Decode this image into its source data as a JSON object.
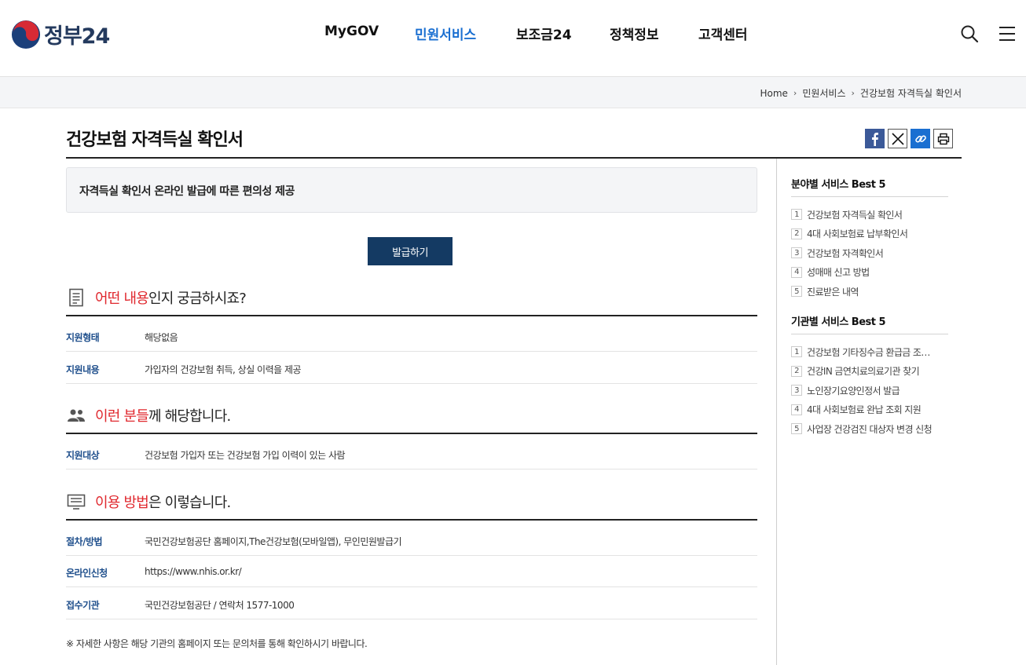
{
  "header": {
    "logo_text": "정부24",
    "nav": [
      {
        "label": "MyGOV"
      },
      {
        "label": "민원서비스"
      },
      {
        "label": "보조금24"
      },
      {
        "label": "정책정보"
      },
      {
        "label": "고객센터"
      }
    ],
    "active_nav": "민원서비스",
    "icons": [
      "search-icon",
      "menu-icon"
    ]
  },
  "breadcrumb": [
    "Home",
    "민원서비스",
    "건강보험 자격득실 확인서"
  ],
  "page": {
    "title": "건강보험 자격득실 확인서",
    "share": [
      "facebook-icon",
      "x-icon",
      "link-icon",
      "print-icon"
    ],
    "summary": "자격득실 확인서 온라인 발급에 따른 편의성 제공",
    "issue_button": "발급하기"
  },
  "sections": [
    {
      "icon": "document-icon",
      "title_hl": "어떤 내용",
      "title_rest": "인지 궁금하시죠?",
      "rows": [
        {
          "k": "지원형태",
          "v": "해당없음"
        },
        {
          "k": "지원내용",
          "v": "가입자의 건강보험 취득, 상실 이력을 제공"
        }
      ]
    },
    {
      "icon": "people-icon",
      "title_hl": "이런 분들",
      "title_rest": "께 해당합니다.",
      "rows": [
        {
          "k": "지원대상",
          "v": "건강보험 가입자 또는 건강보험 가입 이력이 있는 사람"
        }
      ]
    },
    {
      "icon": "monitor-icon",
      "title_hl": "이용 방법",
      "title_rest": "은 이렇습니다.",
      "rows": [
        {
          "k": "절차/방법",
          "v": "국민건강보험공단 홈페이지,The건강보험(모바일앱), 무인민원발급기"
        },
        {
          "k": "온라인신청",
          "v": "https://www.nhis.or.kr/"
        },
        {
          "k": "접수기관",
          "v": "국민건강보험공단 / 연락처 1577-1000"
        }
      ]
    }
  ],
  "note": "※ 자세한 사항은 해당 기관의 홈페이지 또는 문의처를 통해 확인하시기 바랍니다.",
  "side": {
    "field_best": {
      "title": "분야별 서비스 Best 5",
      "items": [
        {
          "num": "1",
          "label": "건강보험 자격득실 확인서"
        },
        {
          "num": "2",
          "label": "4대 사회보험료 납부확인서"
        },
        {
          "num": "3",
          "label": "건강보험 자격확인서"
        },
        {
          "num": "4",
          "label": "성매매 신고 방법"
        },
        {
          "num": "5",
          "label": "진료받은 내역"
        }
      ]
    },
    "agency_best": {
      "title": "기관별 서비스 Best 5",
      "items": [
        {
          "num": "1",
          "label": "건강보험 기타징수금 환급금 조…"
        },
        {
          "num": "2",
          "label": "건강IN 금연치료의료기관 찾기"
        },
        {
          "num": "3",
          "label": "노인장기요양인정서 발급"
        },
        {
          "num": "4",
          "label": "4대 사회보험료 완납 조회 지원"
        },
        {
          "num": "5",
          "label": "사업장 건강검진 대상자 변경 신청"
        }
      ]
    }
  },
  "colors": {
    "accent_blue": "#1a6fd1",
    "button_navy": "#143a63",
    "highlight_red": "#e0282e",
    "label_blue": "#1f4f8c"
  }
}
